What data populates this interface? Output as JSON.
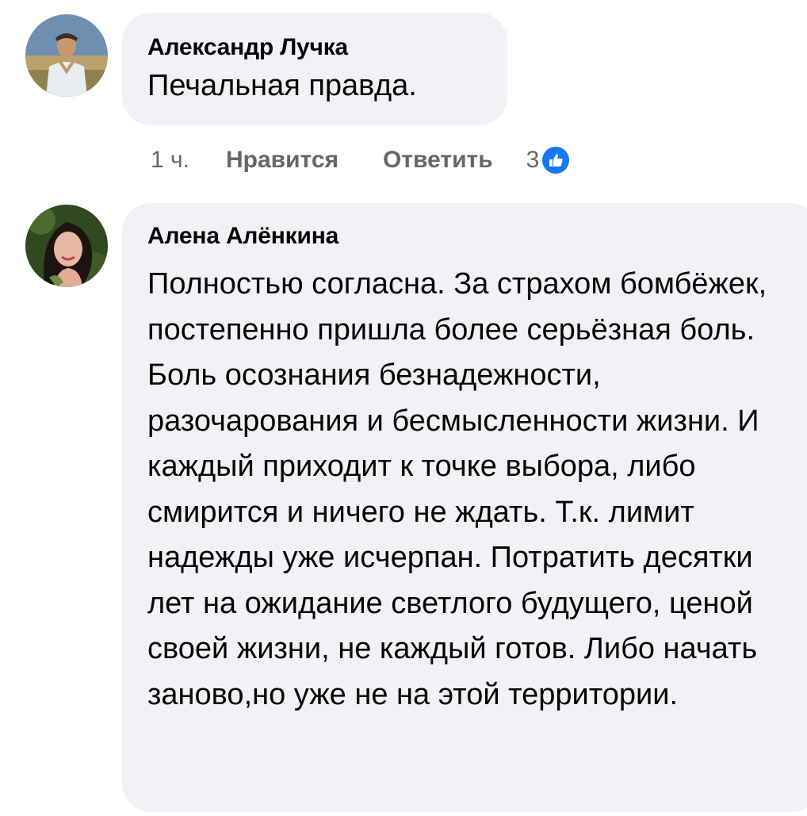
{
  "comments": [
    {
      "author": "Александр Лучка",
      "text": "Печальная правда.",
      "meta": {
        "time": "1 ч.",
        "like_label": "Нравится",
        "reply_label": "Ответить",
        "reaction_count": "3"
      }
    },
    {
      "author": "Алена Алёнкина",
      "text": "Полностью согласна. За страхом бомбёжек,  постепенно пришла более серьёзная боль. Боль осознания безнадежности, разочарования и бесмысленности жизни. И каждый приходит к точке выбора, либо смирится и ничего не ждать. Т.к. лимит надежды уже исчерпан. Потратить десятки лет на ожидание светлого будущего, ценой своей жизни, не каждый готов. Либо начать заново,но уже не на этой территории."
    }
  ],
  "icons": {
    "reaction": "like-thumb-icon"
  },
  "colors": {
    "bubble": "#f0f2f5",
    "meta_text": "#65676b",
    "like_blue": "#1877f2"
  }
}
